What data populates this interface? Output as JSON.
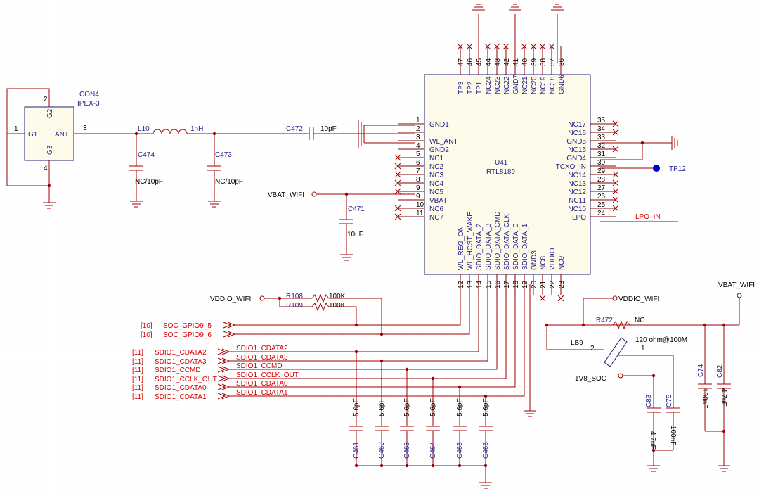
{
  "u41": {
    "ref": "U41",
    "part": "RTL8189",
    "left_pins": [
      {
        "num": "1",
        "name": "GND1"
      },
      {
        "num": "2",
        "name": ""
      },
      {
        "num": "3",
        "name": "WL_ANT"
      },
      {
        "num": "4",
        "name": "GND2"
      },
      {
        "num": "5",
        "name": "NC1"
      },
      {
        "num": "6",
        "name": "NC2"
      },
      {
        "num": "7",
        "name": "NC3"
      },
      {
        "num": "8",
        "name": "NC4"
      },
      {
        "num": "9",
        "name": "NC5"
      },
      {
        "num": "9",
        "name": "VBAT"
      },
      {
        "num": "10",
        "name": "NC6"
      },
      {
        "num": "11",
        "name": "NC7"
      }
    ],
    "right_pins": [
      {
        "num": "35",
        "name": "NC17"
      },
      {
        "num": "34",
        "name": "NC16"
      },
      {
        "num": "33",
        "name": "GND5"
      },
      {
        "num": "32",
        "name": "NC15"
      },
      {
        "num": "31",
        "name": "GND4"
      },
      {
        "num": "30",
        "name": "TCXO_IN"
      },
      {
        "num": "29",
        "name": "NC14"
      },
      {
        "num": "28",
        "name": "NC13"
      },
      {
        "num": "27",
        "name": "NC12"
      },
      {
        "num": "26",
        "name": "NC11"
      },
      {
        "num": "25",
        "name": "NC10"
      },
      {
        "num": "24",
        "name": "LPO"
      }
    ],
    "top_pins": [
      {
        "num": "47",
        "name": "TP3"
      },
      {
        "num": "46",
        "name": "TP2"
      },
      {
        "num": "45",
        "name": "TP1"
      },
      {
        "num": "44",
        "name": "NC24"
      },
      {
        "num": "43",
        "name": "NC23"
      },
      {
        "num": "42",
        "name": "NC22"
      },
      {
        "num": "41",
        "name": "GND7"
      },
      {
        "num": "40",
        "name": "NC21"
      },
      {
        "num": "39",
        "name": "NC20"
      },
      {
        "num": "38",
        "name": "NC19"
      },
      {
        "num": "37",
        "name": "NC18"
      },
      {
        "num": "36",
        "name": "GND6"
      }
    ],
    "bottom_pins": [
      {
        "num": "12",
        "name": "WL_REG_ON"
      },
      {
        "num": "13",
        "name": "WL_HOST_WAKE"
      },
      {
        "num": "14",
        "name": "SDIO_DATA_2"
      },
      {
        "num": "15",
        "name": "SDIO_DATA_3"
      },
      {
        "num": "16",
        "name": "SDIO_DATA_CMD"
      },
      {
        "num": "17",
        "name": "SDIO_DATA_CLK"
      },
      {
        "num": "18",
        "name": "SDIO_DATA_0"
      },
      {
        "num": "19",
        "name": "SDIO_DATA_1"
      },
      {
        "num": "20",
        "name": "GND3"
      },
      {
        "num": "21",
        "name": "NC8"
      },
      {
        "num": "22",
        "name": "VDDIO"
      },
      {
        "num": "23",
        "name": "NC9"
      }
    ]
  },
  "con4": {
    "ref": "CON4",
    "part": "IPEX-3",
    "g1": "G1",
    "g2": "G2",
    "g3": "G3",
    "ant": "ANT",
    "p1": "1",
    "p2": "2",
    "p3": "3",
    "p4": "4"
  },
  "rf": {
    "l10": "L10",
    "l10_val": "1nH",
    "c474": "C474",
    "c474_val": "NC/10pF",
    "c473": "C473",
    "c473_val": "NC/10pF",
    "c472": "C472",
    "c472_val": "10pF"
  },
  "power": {
    "vbat_wifi": "VBAT_WIFI",
    "c471": "C471",
    "c471_val": "10uF",
    "vddio_wifi": "VDDIO_WIFI",
    "tp12": "TP12",
    "lpo_in": "LPO_IN"
  },
  "pullups": {
    "r108": "R108",
    "r108_val": "100K",
    "r109": "R109",
    "r109_val": "100K"
  },
  "signals": [
    {
      "sheet": "[10]",
      "name": "SOC_GPIO9_5"
    },
    {
      "sheet": "[10]",
      "name": "SOC_GPIO9_6"
    },
    {
      "sheet": "[11]",
      "name": "SDIO1_CDATA2"
    },
    {
      "sheet": "[11]",
      "name": "SDIO1_CDATA3"
    },
    {
      "sheet": "[11]",
      "name": "SDIO1_CCMD"
    },
    {
      "sheet": "[11]",
      "name": "SDIO1_CCLK_OUT"
    },
    {
      "sheet": "[11]",
      "name": "SDIO1_CDATA0"
    },
    {
      "sheet": "[11]",
      "name": "SDIO1_CDATA1"
    }
  ],
  "net_labels": [
    "SDIO1_CDATA2",
    "SDIO1_CDATA3",
    "SDIO1_CCMD",
    "SDIO1_CCLK_OUT",
    "SDIO1_CDATA0",
    "SDIO1_CDATA1"
  ],
  "sdio_caps": [
    {
      "ref": "C461",
      "val": "5.6pF"
    },
    {
      "ref": "C462",
      "val": "5.6pF"
    },
    {
      "ref": "C463",
      "val": "5.6pF"
    },
    {
      "ref": "C464",
      "val": "5.6pF"
    },
    {
      "ref": "C465",
      "val": "5.6pF"
    },
    {
      "ref": "C466",
      "val": "5.6pF"
    }
  ],
  "vddio_block": {
    "r472": "R472",
    "r472_val": "NC",
    "lb9": "LB9",
    "lb9_val": "120 ohm@100M",
    "lb9_p2": "2",
    "lb9_p1": "1",
    "v1v8": "1V8_SOC",
    "c83": "C83",
    "c83_val": "4.7uF",
    "c75": "C75",
    "c75_val": "100nF",
    "c74": "C74",
    "c74_val": "100nF",
    "c82": "C82",
    "c82_val": "4.7uF"
  },
  "colors": {
    "wire": "#a00000",
    "body_fill": "#fffbea",
    "body_stroke": "#1f1f6f",
    "pin_text": "#1f1f8a",
    "signal_text": "#d40000"
  }
}
